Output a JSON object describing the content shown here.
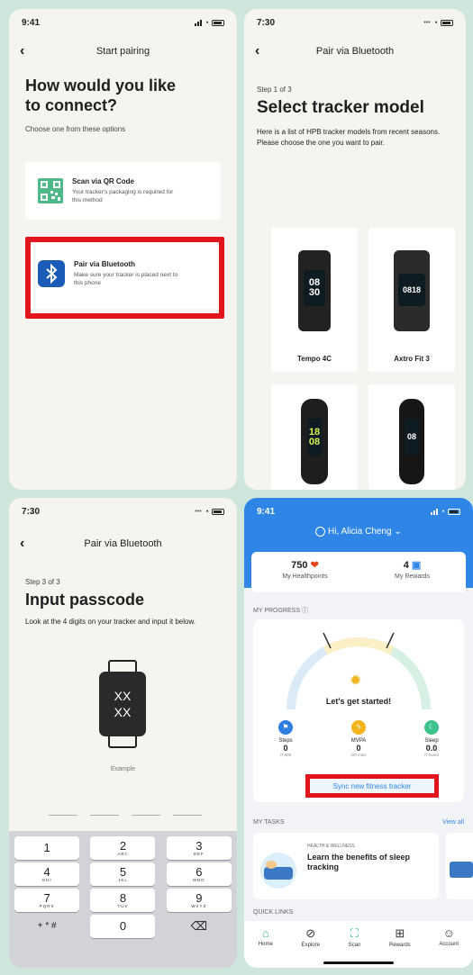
{
  "screen1": {
    "status_time": "9:41",
    "nav_title": "Start pairing",
    "heading": "How would you like to connect?",
    "subtitle": "Choose one from these options",
    "option_qr": {
      "title": "Scan via QR Code",
      "desc": "Your tracker's packaging is required for this method"
    },
    "option_bt": {
      "title": "Pair via Bluetooth",
      "desc": "Make sure your tracker is placed next to this phone"
    }
  },
  "screen2": {
    "status_time": "7:30",
    "nav_title": "Pair via Bluetooth",
    "step": "Step 1 of 3",
    "heading": "Select tracker model",
    "desc": "Here is a list of HPB tracker models from recent seasons. Please choose the one you want to pair.",
    "models": [
      {
        "name": "Tempo 4C",
        "screen_a": "08",
        "screen_b": "30"
      },
      {
        "name": "Axtro Fit 3",
        "screen_a": "0818",
        "screen_b": ""
      },
      {
        "name": "",
        "screen_a": "18",
        "screen_b": "08"
      },
      {
        "name": "",
        "screen_a": "08",
        "screen_b": ""
      }
    ]
  },
  "screen3": {
    "status_time": "7:30",
    "nav_title": "Pair via Bluetooth",
    "step": "Step 3 of 3",
    "heading": "Input passcode",
    "desc": "Look at the 4 digits on your tracker and input it below.",
    "tracker_line1": "XX",
    "tracker_line2": "XX",
    "example_label": "Example",
    "keys": [
      [
        {
          "n": "1",
          "l": ""
        },
        {
          "n": "2",
          "l": "ABC"
        },
        {
          "n": "3",
          "l": "DEF"
        }
      ],
      [
        {
          "n": "4",
          "l": "GHI"
        },
        {
          "n": "5",
          "l": "JKL"
        },
        {
          "n": "6",
          "l": "MNO"
        }
      ],
      [
        {
          "n": "7",
          "l": "PQRS"
        },
        {
          "n": "8",
          "l": "TUV"
        },
        {
          "n": "9",
          "l": "WXYZ"
        }
      ],
      [
        {
          "n": "+ * #",
          "l": ""
        },
        {
          "n": "0",
          "l": ""
        },
        {
          "n": "⌫",
          "l": ""
        }
      ]
    ]
  },
  "screen4": {
    "status_time": "9:41",
    "greeting": "Hi, Alicia Cheng",
    "points_value": "750",
    "points_label": "My Healthpoints",
    "rewards_value": "4",
    "rewards_label": "My Rewards",
    "progress_title": "MY PROGRESS ⓘ",
    "gauge_text": "Let's get started!",
    "metrics": [
      {
        "label": "Steps",
        "value": "0",
        "target": "/7,000",
        "color": "#2f7de1"
      },
      {
        "label": "MVPA",
        "value": "0",
        "target": "/20 mins",
        "color": "#f3b51d"
      },
      {
        "label": "Sleep",
        "value": "0.0",
        "target": "/7 hours",
        "color": "#3cc28a"
      }
    ],
    "sync_button": "Sync new fitness tracker",
    "tasks_title": "MY TASKS",
    "view_all": "View all",
    "task_tag": "HEALTH & WELLNESS",
    "task_title": "Learn the benefits of sleep tracking",
    "quicklinks_title": "QUICK LINKS",
    "tabs": [
      {
        "label": "Home",
        "icon": "⌂"
      },
      {
        "label": "Explore",
        "icon": "⊘"
      },
      {
        "label": "Scan",
        "icon": "⛶"
      },
      {
        "label": "Rewards",
        "icon": "⊞"
      },
      {
        "label": "Account",
        "icon": "☺"
      }
    ],
    "accent": "#2f86e6"
  }
}
